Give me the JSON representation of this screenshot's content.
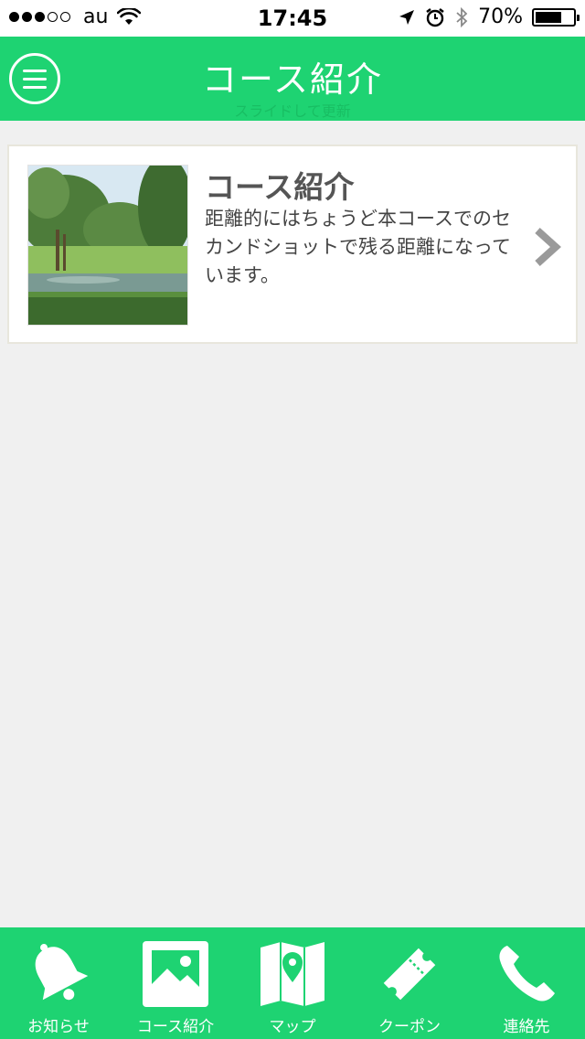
{
  "status_bar": {
    "carrier": "au",
    "time": "17:45",
    "battery_percent": "70%",
    "battery_level": 0.7,
    "signal_bars_filled": 3,
    "signal_bars_total": 5
  },
  "header": {
    "title": "コース紹介",
    "pull_hint": "スライドして更新",
    "menu_icon": "hamburger-menu-icon"
  },
  "list": {
    "items": [
      {
        "title": "コース紹介",
        "description": "距離的にはちょうど本コースでのセカンドショットで残る距離になっています。",
        "thumbnail": "golf-course-photo",
        "chevron_icon": "chevron-right-icon"
      }
    ]
  },
  "tab_bar": {
    "tabs": [
      {
        "label": "お知らせ",
        "icon": "bell-icon"
      },
      {
        "label": "コース紹介",
        "icon": "image-icon"
      },
      {
        "label": "マップ",
        "icon": "map-pin-icon"
      },
      {
        "label": "クーポン",
        "icon": "ticket-icon"
      },
      {
        "label": "連絡先",
        "icon": "phone-icon"
      }
    ]
  },
  "colors": {
    "accent": "#1ed372",
    "background": "#f0f0f0",
    "card_border": "#e8e6dc"
  }
}
